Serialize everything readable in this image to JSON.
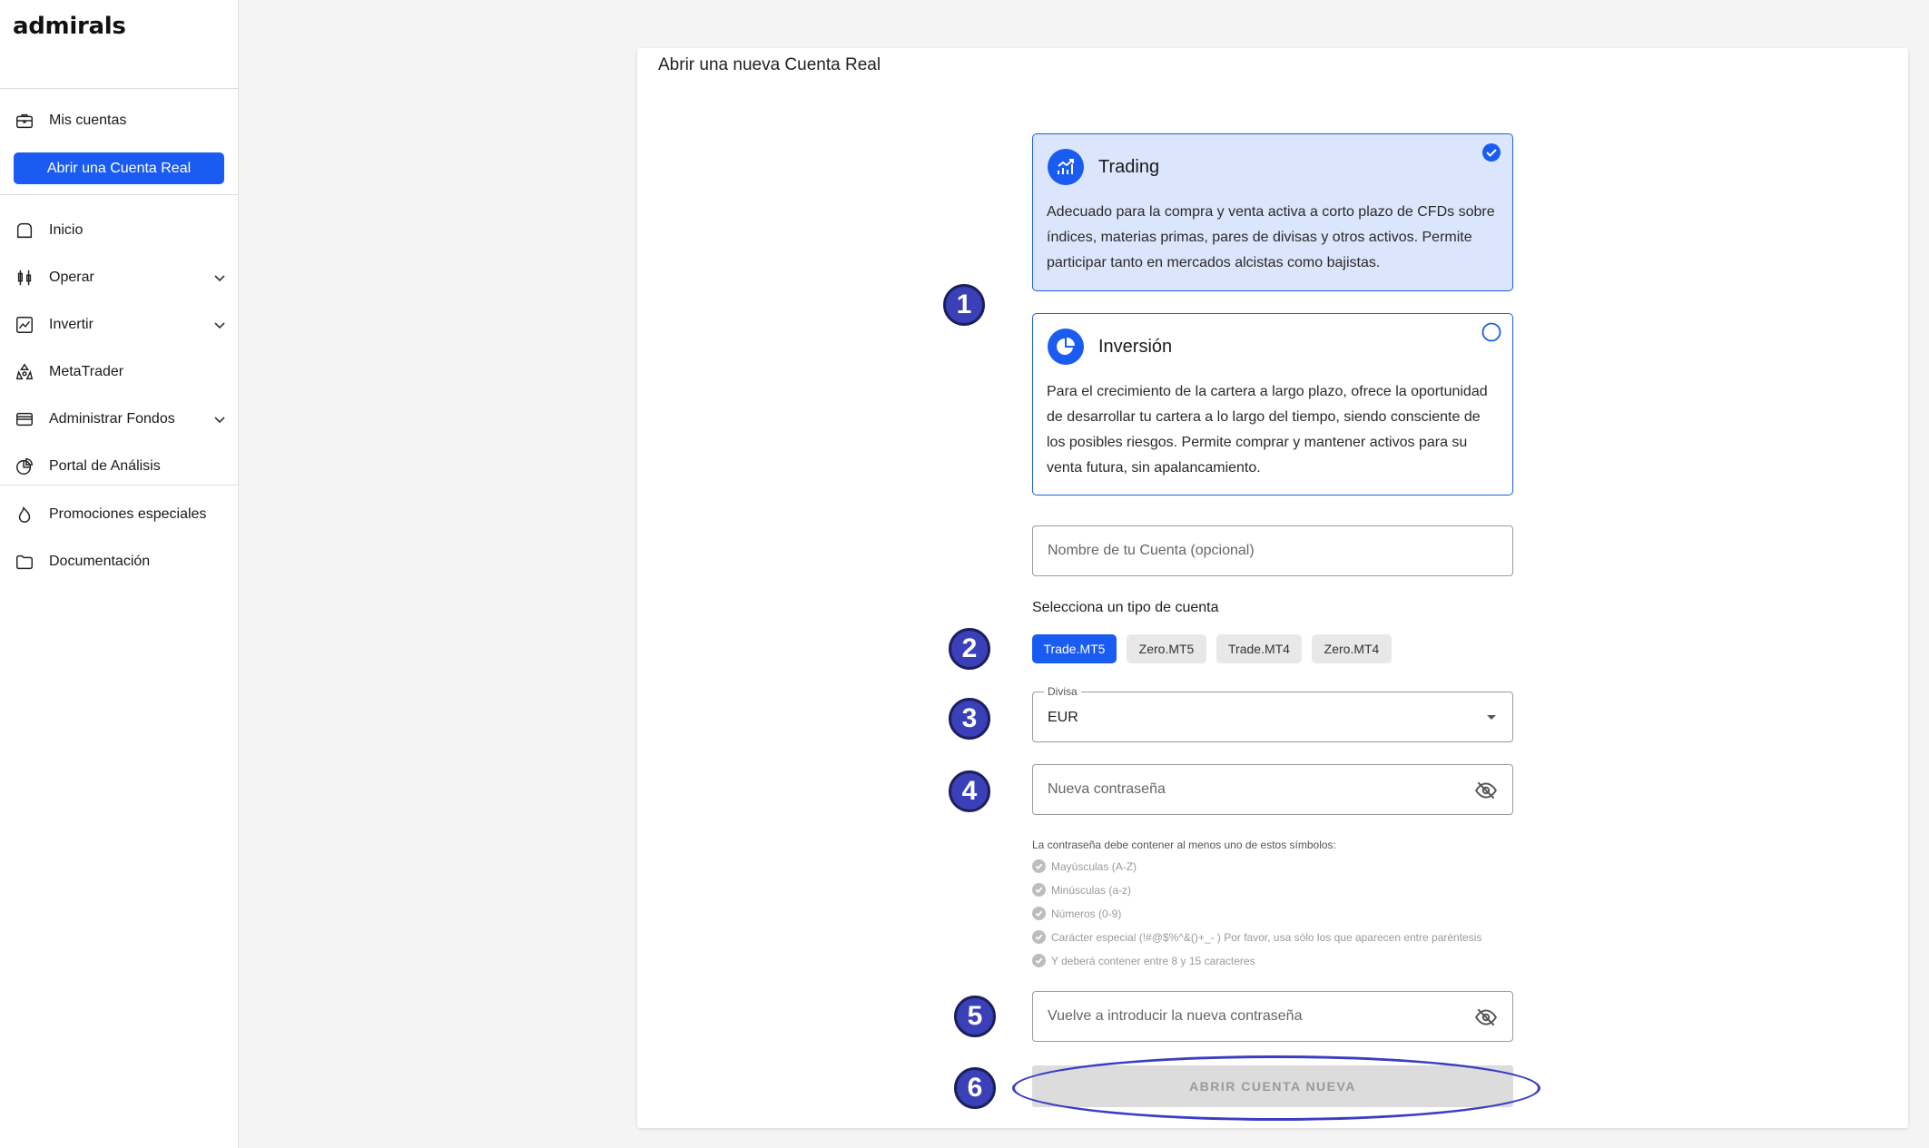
{
  "app": {
    "logo": "admirals"
  },
  "sidebar": {
    "items": [
      {
        "label": "Mis cuentas",
        "icon": "briefcase-icon"
      },
      {
        "label": "Abrir una Cuenta Real"
      },
      {
        "label": "Inicio",
        "icon": "home-icon"
      },
      {
        "label": "Operar",
        "icon": "candlestick-icon",
        "expandable": true
      },
      {
        "label": "Invertir",
        "icon": "trend-chart-icon",
        "expandable": true
      },
      {
        "label": "MetaTrader",
        "icon": "metatrader-icon"
      },
      {
        "label": "Administrar Fondos",
        "icon": "wallet-icon",
        "expandable": true
      },
      {
        "label": "Portal de Análisis",
        "icon": "pie-chart-icon"
      },
      {
        "label": "Promociones especiales",
        "icon": "flame-icon"
      },
      {
        "label": "Documentación",
        "icon": "folder-icon"
      }
    ]
  },
  "main": {
    "title": "Abrir una nueva Cuenta Real",
    "options": [
      {
        "title": "Trading",
        "icon": "trend-up-icon",
        "selected": true,
        "description": "Adecuado para la compra y venta activa a corto plazo de CFDs sobre índices, materias primas, pares de divisas y otros activos. Permite participar tanto en mercados alcistas como bajistas."
      },
      {
        "title": "Inversión",
        "icon": "pie-chart-icon",
        "selected": false,
        "description": "Para el crecimiento de la cartera a largo plazo, ofrece la oportunidad de desarrollar tu cartera a lo largo del tiempo, siendo consciente de los posibles riesgos. Permite comprar y mantener activos para su venta futura, sin apalancamiento."
      }
    ],
    "account_name": {
      "placeholder": "Nombre de tu Cuenta (opcional)",
      "value": ""
    },
    "account_type_label": "Selecciona un tipo de cuenta",
    "account_types": [
      {
        "label": "Trade.MT5",
        "active": true
      },
      {
        "label": "Zero.MT5",
        "active": false
      },
      {
        "label": "Trade.MT4",
        "active": false
      },
      {
        "label": "Zero.MT4",
        "active": false
      }
    ],
    "currency": {
      "label": "Divisa",
      "value": "EUR"
    },
    "password": {
      "placeholder": "Nueva contraseña",
      "value": ""
    },
    "password_note": "La contraseña debe contener al menos uno de estos símbolos:",
    "password_rules": [
      "Mayúsculas (A-Z)",
      "Minúsculas (a-z)",
      "Números (0-9)",
      "Carácter especial (!#@$%^&()+_- ) Por favor, usa sólo los que aparecen entre paréntesis",
      "Y deberá contener entre 8 y 15 caracteres"
    ],
    "password_confirm": {
      "placeholder": "Vuelve a introducir la nueva contraseña",
      "value": ""
    },
    "submit_label": "ABRIR CUENTA NUEVA"
  },
  "annotations": [
    "1",
    "2",
    "3",
    "4",
    "5",
    "6"
  ],
  "colors": {
    "accent": "#1a5cf2",
    "selected_bg": "#dbe5fb",
    "annotation": "#3940b8"
  }
}
